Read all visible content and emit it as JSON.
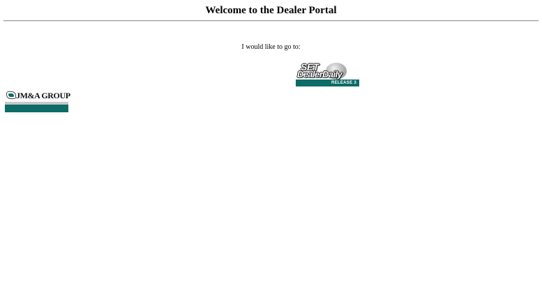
{
  "page": {
    "title": "Welcome to the Dealer Portal",
    "prompt": "I would like to go to:"
  },
  "links": {
    "dealer_daily": {
      "line1": "SET",
      "line2": "DealerDaily",
      "release": "RELEASE 3"
    },
    "jma_group": {
      "text": "JM&A GROUP"
    }
  },
  "colors": {
    "background": "#ffffff",
    "text": "#000000",
    "brand_teal": "#0d6b68",
    "rule": "#9a9a9a"
  },
  "icons": {
    "dealer_daily_globe": "globe-icon",
    "jma_mark": "jma-mark-icon"
  }
}
